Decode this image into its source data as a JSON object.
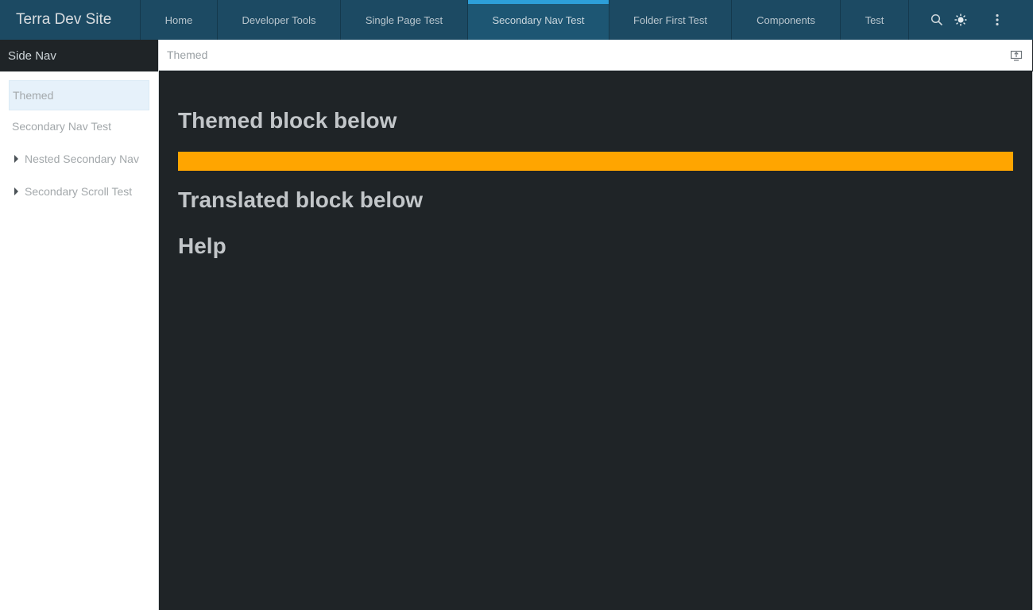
{
  "header": {
    "title": "Terra Dev Site",
    "nav": [
      {
        "label": "Home"
      },
      {
        "label": "Developer Tools"
      },
      {
        "label": "Single Page Test"
      },
      {
        "label": "Secondary Nav Test",
        "active": true
      },
      {
        "label": "Folder First Test"
      },
      {
        "label": "Components"
      },
      {
        "label": "Test"
      }
    ],
    "utilities": {
      "search_icon": "search-icon",
      "theme_icon": "sun-icon",
      "menu_icon": "more-vertical-icon"
    }
  },
  "side_nav": {
    "title": "Side Nav",
    "items": [
      {
        "label": "Themed",
        "selected": true
      },
      {
        "label": "Secondary Nav Test"
      },
      {
        "label": "Nested Secondary Nav",
        "expandable": true
      },
      {
        "label": "Secondary Scroll Test",
        "expandable": true
      }
    ]
  },
  "content": {
    "header_title": "Themed",
    "sections": [
      {
        "heading": "Themed block below"
      },
      {
        "heading": "Translated block below"
      },
      {
        "heading": "Help"
      }
    ],
    "themed_block_color": "#ffa500"
  },
  "colors": {
    "header_bg": "#1c4a63",
    "active_indicator": "#2d9fd9",
    "content_bg": "#1f2427",
    "selected_item_bg": "#e6f1fa"
  }
}
